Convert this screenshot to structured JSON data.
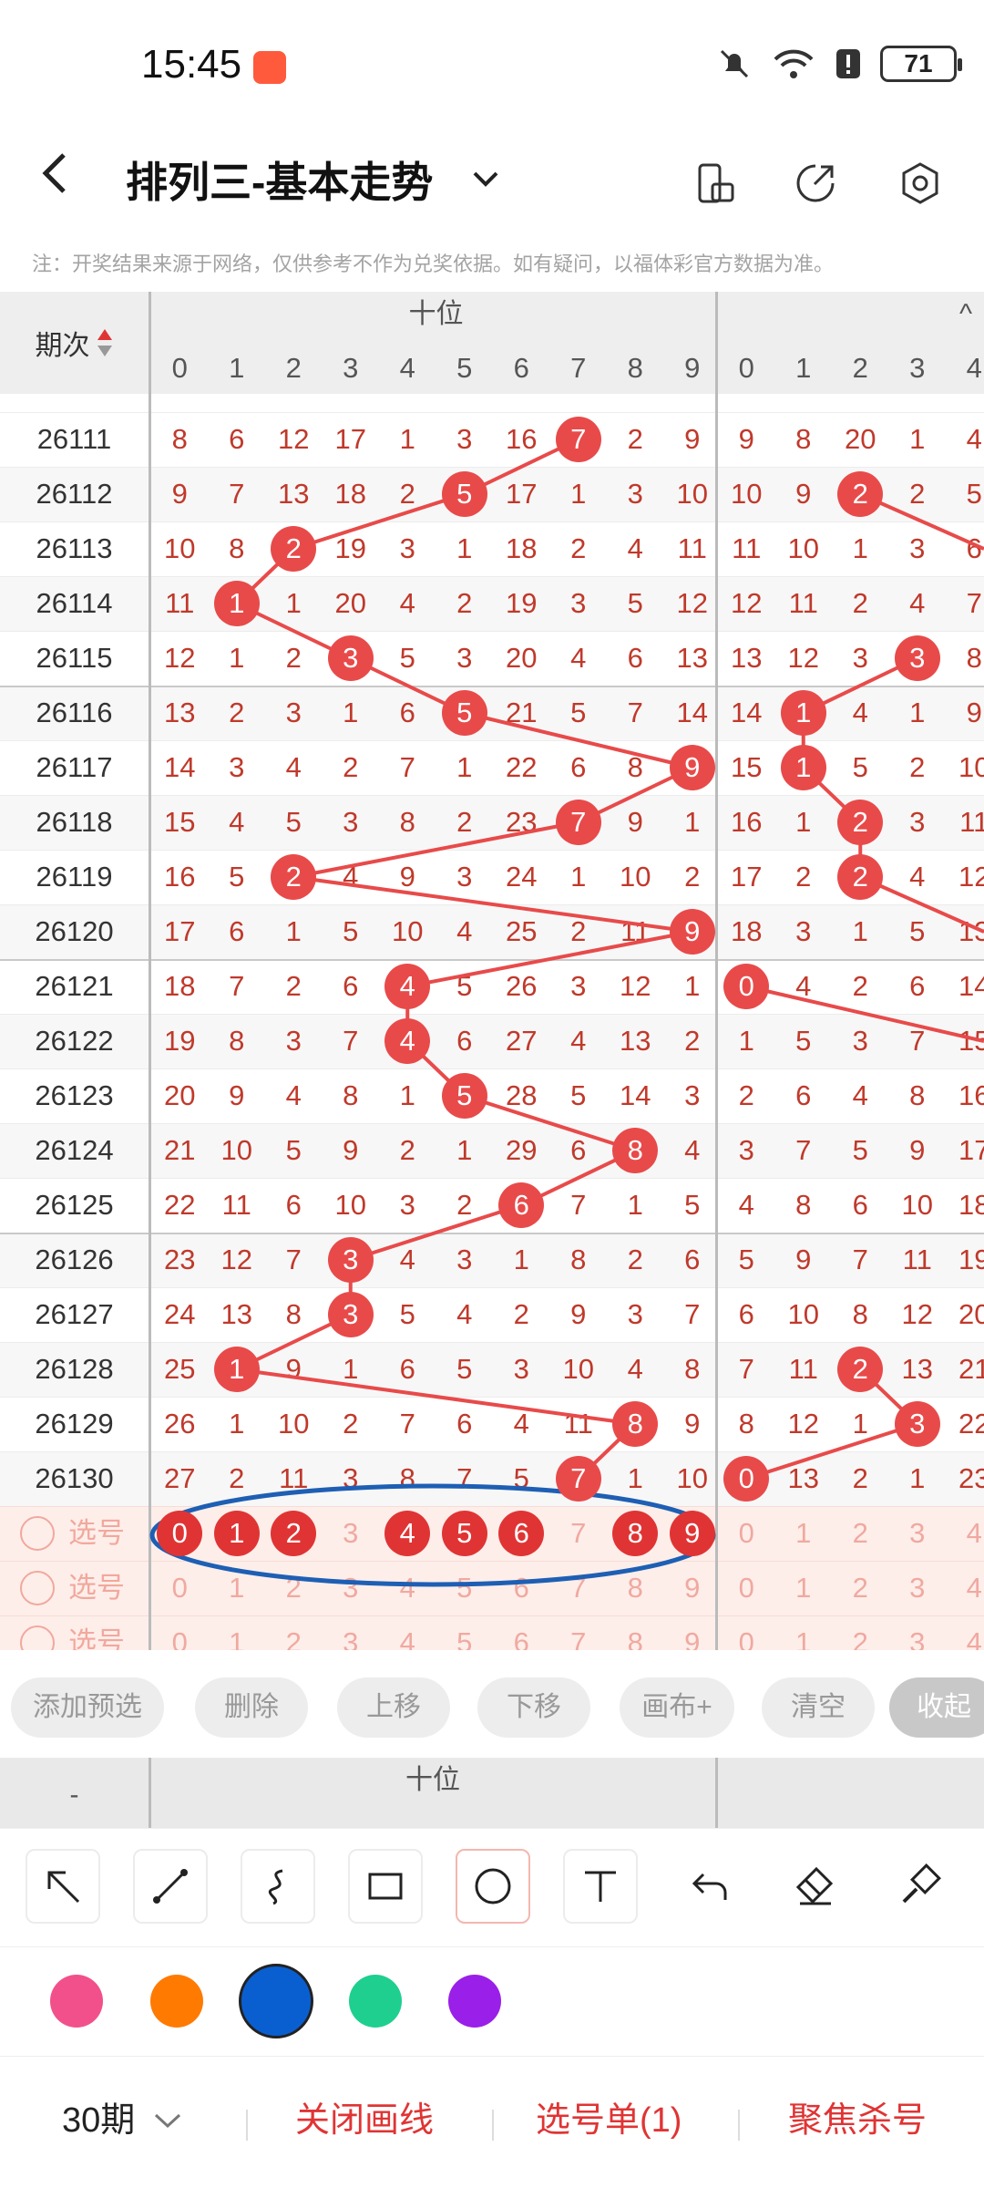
{
  "status_bar": {
    "time": "15:45",
    "battery": "71"
  },
  "header": {
    "title": "排列三-基本走势",
    "back_icon": "back-arrow-icon"
  },
  "notice": "注：开奖结果来源于网络，仅供参考不作为兑奖依据。如有疑问，以福体彩官方数据为准。",
  "table": {
    "period_header": "期次",
    "group_label": "十位",
    "digits": [
      "0",
      "1",
      "2",
      "3",
      "4",
      "5",
      "6",
      "7",
      "8",
      "9"
    ],
    "rows": [
      {
        "period": "26111",
        "tens": [
          8,
          6,
          12,
          17,
          1,
          3,
          16,
          7,
          2,
          9
        ],
        "tens_hit": 7,
        "units": [
          9,
          8,
          20,
          1,
          4
        ],
        "units_hit": -1
      },
      {
        "period": "26112",
        "tens": [
          9,
          7,
          13,
          18,
          2,
          5,
          17,
          1,
          3,
          10
        ],
        "tens_hit": 5,
        "units": [
          10,
          9,
          2,
          2,
          5
        ],
        "units_hit": 2
      },
      {
        "period": "26113",
        "tens": [
          10,
          8,
          2,
          19,
          3,
          1,
          18,
          2,
          4,
          11
        ],
        "tens_hit": 2,
        "units": [
          11,
          10,
          1,
          3,
          6
        ],
        "units_hit": -1
      },
      {
        "period": "26114",
        "tens": [
          11,
          1,
          1,
          20,
          4,
          2,
          19,
          3,
          5,
          12
        ],
        "tens_hit": 1,
        "units": [
          12,
          11,
          2,
          4,
          7
        ],
        "units_hit": -1
      },
      {
        "period": "26115",
        "tens": [
          12,
          1,
          2,
          3,
          5,
          3,
          20,
          4,
          6,
          13
        ],
        "tens_hit": 3,
        "units": [
          13,
          12,
          3,
          3,
          8
        ],
        "units_hit": 3
      },
      {
        "period": "26116",
        "tens": [
          13,
          2,
          3,
          1,
          6,
          5,
          21,
          5,
          7,
          14
        ],
        "tens_hit": 5,
        "units": [
          14,
          1,
          4,
          1,
          9
        ],
        "units_hit": 1
      },
      {
        "period": "26117",
        "tens": [
          14,
          3,
          4,
          2,
          7,
          1,
          22,
          6,
          8,
          9
        ],
        "tens_hit": 9,
        "units": [
          15,
          1,
          5,
          2,
          10
        ],
        "units_hit": 1
      },
      {
        "period": "26118",
        "tens": [
          15,
          4,
          5,
          3,
          8,
          2,
          23,
          7,
          9,
          1
        ],
        "tens_hit": 7,
        "units": [
          16,
          1,
          2,
          3,
          11
        ],
        "units_hit": 2
      },
      {
        "period": "26119",
        "tens": [
          16,
          5,
          2,
          4,
          9,
          3,
          24,
          1,
          10,
          2
        ],
        "tens_hit": 2,
        "units": [
          17,
          2,
          2,
          4,
          12
        ],
        "units_hit": 2
      },
      {
        "period": "26120",
        "tens": [
          17,
          6,
          1,
          5,
          10,
          4,
          25,
          2,
          11,
          9
        ],
        "tens_hit": 9,
        "units": [
          18,
          3,
          1,
          5,
          13
        ],
        "units_hit": -1
      },
      {
        "period": "26121",
        "tens": [
          18,
          7,
          2,
          6,
          4,
          5,
          26,
          3,
          12,
          1
        ],
        "tens_hit": 4,
        "units": [
          0,
          4,
          2,
          6,
          14
        ],
        "units_hit": 0
      },
      {
        "period": "26122",
        "tens": [
          19,
          8,
          3,
          7,
          4,
          6,
          27,
          4,
          13,
          2
        ],
        "tens_hit": 4,
        "units": [
          1,
          5,
          3,
          7,
          15
        ],
        "units_hit": -1
      },
      {
        "period": "26123",
        "tens": [
          20,
          9,
          4,
          8,
          1,
          5,
          28,
          5,
          14,
          3
        ],
        "tens_hit": 5,
        "units": [
          2,
          6,
          4,
          8,
          16
        ],
        "units_hit": -1
      },
      {
        "period": "26124",
        "tens": [
          21,
          10,
          5,
          9,
          2,
          1,
          29,
          6,
          8,
          4
        ],
        "tens_hit": 8,
        "units": [
          3,
          7,
          5,
          9,
          17
        ],
        "units_hit": -1
      },
      {
        "period": "26125",
        "tens": [
          22,
          11,
          6,
          10,
          3,
          2,
          6,
          7,
          1,
          5
        ],
        "tens_hit": 6,
        "units": [
          4,
          8,
          6,
          10,
          18
        ],
        "units_hit": -1
      },
      {
        "period": "26126",
        "tens": [
          23,
          12,
          7,
          3,
          4,
          3,
          1,
          8,
          2,
          6
        ],
        "tens_hit": 3,
        "units": [
          5,
          9,
          7,
          11,
          19
        ],
        "units_hit": -1
      },
      {
        "period": "26127",
        "tens": [
          24,
          13,
          8,
          3,
          5,
          4,
          2,
          9,
          3,
          7
        ],
        "tens_hit": 3,
        "units": [
          6,
          10,
          8,
          12,
          20
        ],
        "units_hit": -1
      },
      {
        "period": "26128",
        "tens": [
          25,
          1,
          9,
          1,
          6,
          5,
          3,
          10,
          4,
          8
        ],
        "tens_hit": 1,
        "units": [
          7,
          11,
          2,
          13,
          21
        ],
        "units_hit": 2
      },
      {
        "period": "26129",
        "tens": [
          26,
          1,
          10,
          2,
          7,
          6,
          4,
          11,
          8,
          9
        ],
        "tens_hit": 8,
        "units": [
          8,
          12,
          1,
          3,
          22
        ],
        "units_hit": 3
      },
      {
        "period": "26130",
        "tens": [
          27,
          2,
          11,
          3,
          8,
          7,
          5,
          7,
          1,
          10
        ],
        "tens_hit": 7,
        "units": [
          0,
          13,
          2,
          1,
          23
        ],
        "units_hit": 0
      }
    ],
    "pick_label": "选号",
    "selected_tens": [
      0,
      1,
      2,
      4,
      5,
      6,
      8,
      9
    ]
  },
  "actions": [
    "添加预选",
    "删除",
    "上移",
    "下移",
    "画布+",
    "清空",
    "收起"
  ],
  "mini_header": {
    "label": "十位"
  },
  "tools": [
    "arrow-tool-icon",
    "line-tool-icon",
    "curve-tool-icon",
    "rectangle-tool-icon",
    "circle-tool-icon",
    "text-tool-icon",
    "undo-icon",
    "eraser-icon",
    "brush-icon"
  ],
  "colors": [
    "#f2508a",
    "#ff7a00",
    "#0a5fd0",
    "#1fcf8f",
    "#9a1fe8"
  ],
  "bottom": {
    "periods": "30期",
    "close_draw": "关闭画线",
    "pick_list": "选号单(1)",
    "focus_kill": "聚焦杀号"
  },
  "theme": {
    "accent": "#e84a4a",
    "circle_annotation": "#1e5fb4"
  }
}
